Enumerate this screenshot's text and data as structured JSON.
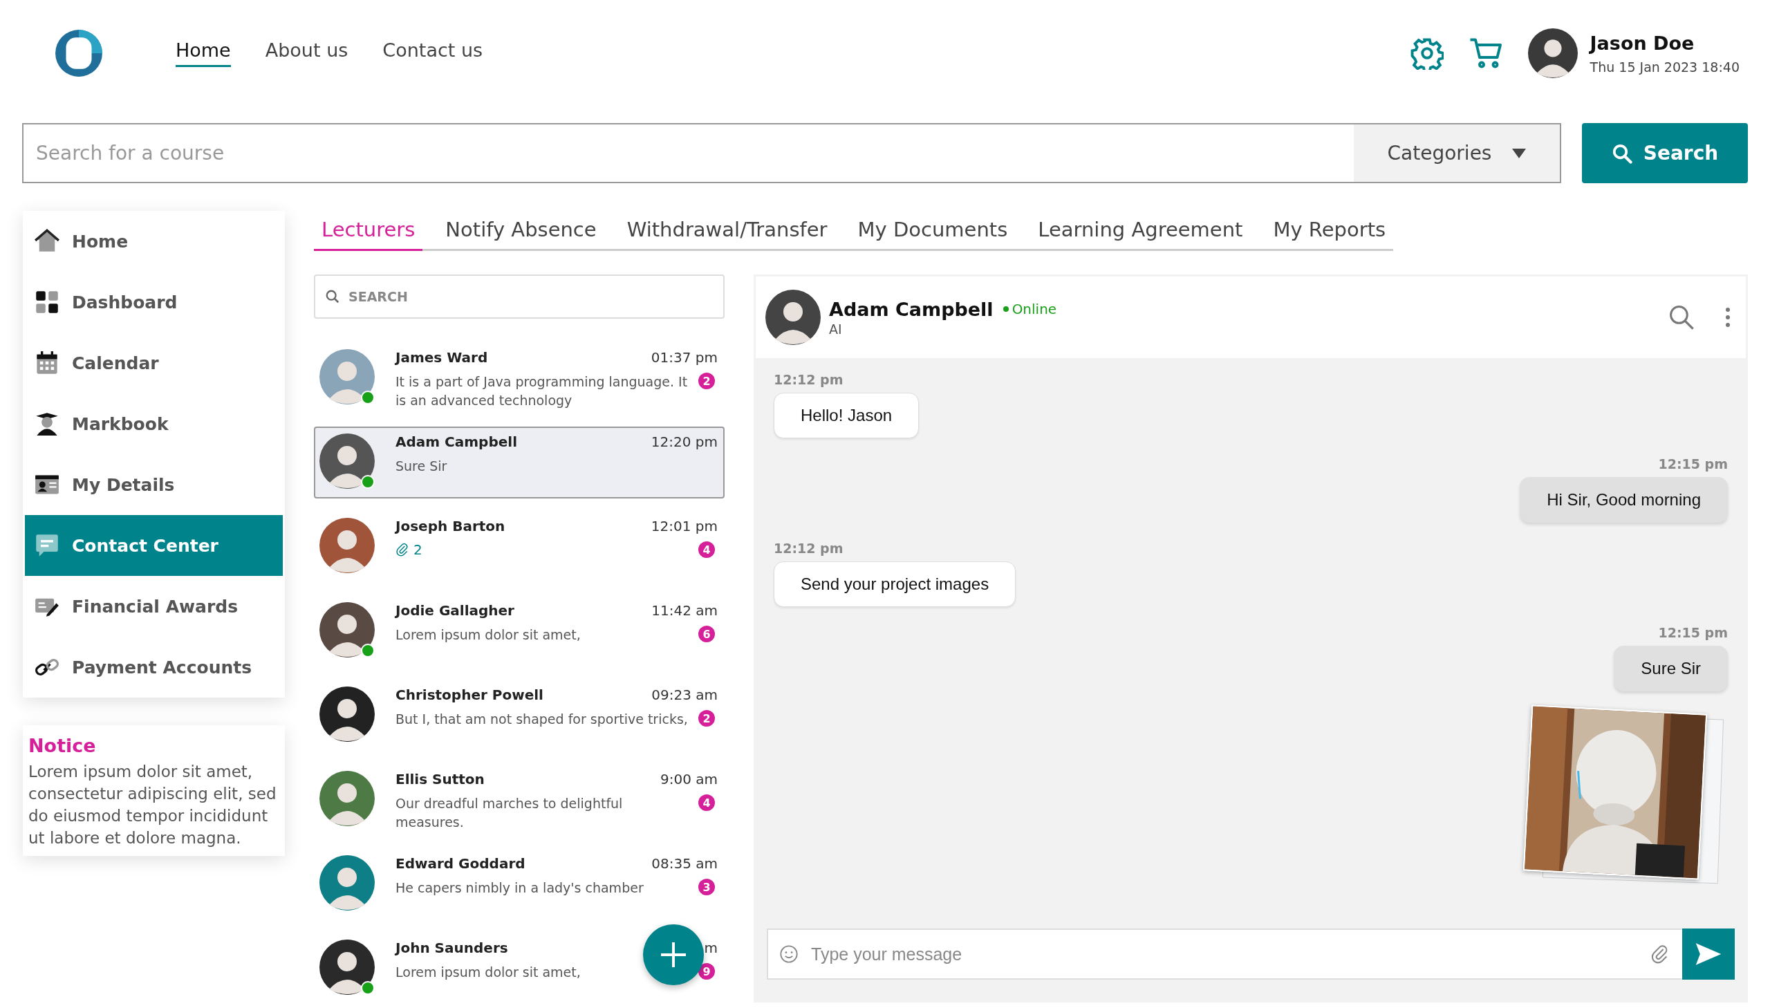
{
  "header": {
    "nav": [
      {
        "label": "Home",
        "selected": true
      },
      {
        "label": "About us",
        "selected": false
      },
      {
        "label": "Contact us",
        "selected": false
      }
    ],
    "user": {
      "name": "Jason Doe",
      "datetime": "Thu 15 Jan 2023 18:40"
    }
  },
  "course_search": {
    "placeholder": "Search for a course",
    "category": "Categories",
    "button": "Search"
  },
  "sidebar": {
    "items": [
      {
        "label": "Home",
        "selected": false
      },
      {
        "label": "Dashboard",
        "selected": false
      },
      {
        "label": "Calendar",
        "selected": false
      },
      {
        "label": "Markbook",
        "selected": false
      },
      {
        "label": "My Details",
        "selected": false
      },
      {
        "label": "Contact Center",
        "selected": true
      },
      {
        "label": "Financial Awards",
        "selected": false
      },
      {
        "label": "Payment Accounts",
        "selected": false
      }
    ],
    "notice": {
      "title": "Notice",
      "text": "Lorem ipsum dolor sit amet, consectetur adipiscing elit, sed do eiusmod tempor incididunt ut labore et dolore magna."
    }
  },
  "tabs": [
    {
      "label": "Lecturers",
      "selected": true
    },
    {
      "label": "Notify Absence",
      "selected": false
    },
    {
      "label": "Withdrawal/Transfer",
      "selected": false
    },
    {
      "label": "My Documents",
      "selected": false
    },
    {
      "label": "Learning Agreement",
      "selected": false
    },
    {
      "label": "My Reports",
      "selected": false
    }
  ],
  "contacts": {
    "search_placeholder": "SEARCH",
    "items": [
      {
        "name": "James Ward",
        "time": "01:37 pm",
        "kind": "text",
        "preview": "It is a part of Java programming language. It is an advanced technology",
        "unread": "2",
        "online": true,
        "selected": false
      },
      {
        "name": "Adam Campbell",
        "time": "12:20 pm",
        "kind": "text",
        "preview": "Sure Sir",
        "online": true,
        "selected": true
      },
      {
        "name": "Joseph Barton",
        "time": "12:01 pm",
        "kind": "attachment",
        "preview": "2",
        "unread": "4",
        "online": false,
        "selected": false
      },
      {
        "name": "Jodie Gallagher",
        "time": "11:42 am",
        "kind": "text",
        "preview": "Lorem ipsum dolor sit amet,",
        "unread": "6",
        "online": true,
        "selected": false
      },
      {
        "name": "Christopher Powell",
        "time": "09:23 am",
        "kind": "text",
        "preview": "But I, that am not shaped for sportive tricks,",
        "unread": "2",
        "online": false,
        "selected": false
      },
      {
        "name": "Ellis Sutton",
        "time": "9:00 am",
        "kind": "text",
        "preview": "Our dreadful marches to delightful measures.",
        "unread": "4",
        "online": false,
        "selected": false
      },
      {
        "name": "Edward Goddard",
        "time": "08:35 am",
        "kind": "text",
        "preview": "He capers nimbly in a lady's chamber",
        "unread": "3",
        "online": false,
        "selected": false
      },
      {
        "name": "John Saunders",
        "time": "m",
        "kind": "text",
        "preview": "Lorem ipsum dolor sit amet,",
        "unread": "9",
        "online": true,
        "selected": false
      }
    ]
  },
  "chat": {
    "contact": {
      "name": "Adam Campbell",
      "status": "Online",
      "role": "AI"
    },
    "messages": [
      {
        "kind": "text",
        "outgoing": false,
        "time": "12:12 pm",
        "text": "Hello! Jason"
      },
      {
        "kind": "text",
        "outgoing": true,
        "time": "12:15 pm",
        "text": "Hi Sir, Good morning"
      },
      {
        "kind": "text",
        "outgoing": false,
        "time": "12:12 pm",
        "text": "Send your project images"
      },
      {
        "kind": "text",
        "outgoing": true,
        "time": "12:15 pm",
        "text": "Sure Sir"
      },
      {
        "kind": "picture",
        "outgoing": true
      }
    ],
    "composer_placeholder": "Type your message"
  }
}
